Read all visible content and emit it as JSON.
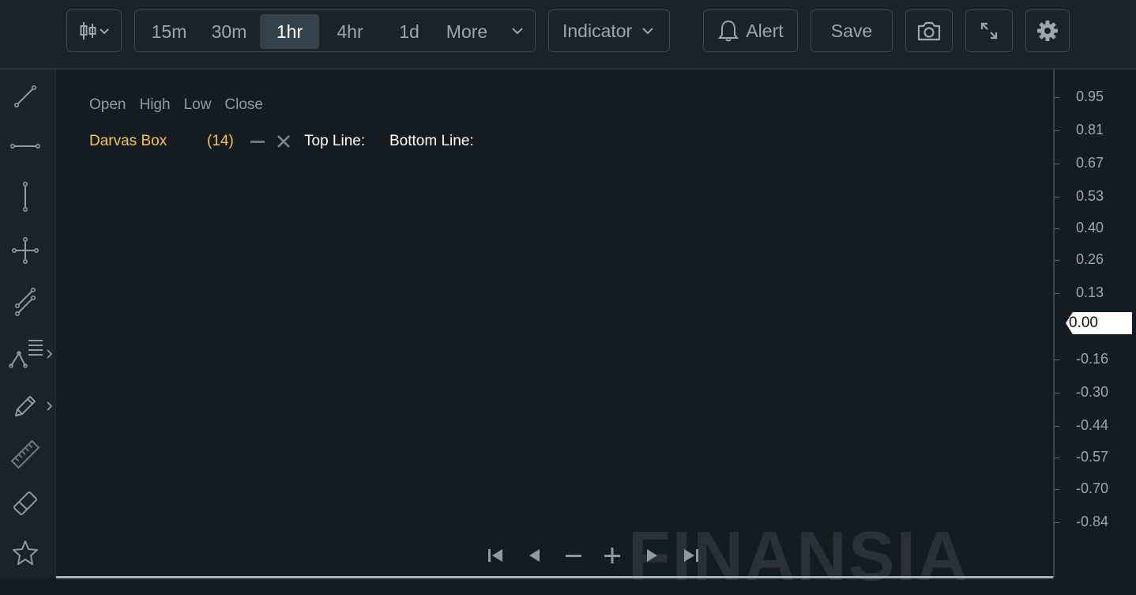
{
  "toolbar": {
    "chart_type_icon": "candlestick-icon",
    "timeframes": [
      "15m",
      "30m",
      "1hr",
      "4hr",
      "1d"
    ],
    "active_timeframe": "1hr",
    "more_label": "More",
    "indicator_label": "Indicator",
    "alert_label": "Alert",
    "save_label": "Save",
    "snapshot_icon": "camera-icon",
    "fullscreen_icon": "expand-icon",
    "settings_icon": "gear-icon"
  },
  "sidebar": {
    "tools": [
      "trend-line-icon",
      "horizontal-line-icon",
      "vertical-line-icon",
      "crosshair-line-icon",
      "parallel-channel-icon",
      "fibonacci-icon",
      "pencil-icon",
      "ruler-icon",
      "eraser-icon",
      "star-icon"
    ]
  },
  "chart": {
    "ohlc_labels": [
      "Open",
      "High",
      "Low",
      "Close"
    ],
    "indicator": {
      "name": "Darvas Box",
      "param": "(14)",
      "top_line_label": "Top Line:",
      "bottom_line_label": "Bottom Line:"
    },
    "watermark": "FINANSIA",
    "nav_icons": [
      "go-to-start-icon",
      "scroll-left-icon",
      "zoom-out-icon",
      "zoom-in-icon",
      "scroll-right-icon",
      "go-to-end-icon"
    ]
  },
  "price_axis": {
    "labels": [
      "0.95",
      "0.81",
      "0.67",
      "0.53",
      "0.40",
      "0.26",
      "0.13",
      "-0.16",
      "-0.30",
      "-0.44",
      "-0.57",
      "-0.70",
      "-0.84"
    ],
    "current_price": "0.00"
  },
  "colors": {
    "background": "#151c21",
    "toolbar": "#1b2328",
    "indicator_accent": "#f5c542",
    "active_tab": "#34414a"
  }
}
